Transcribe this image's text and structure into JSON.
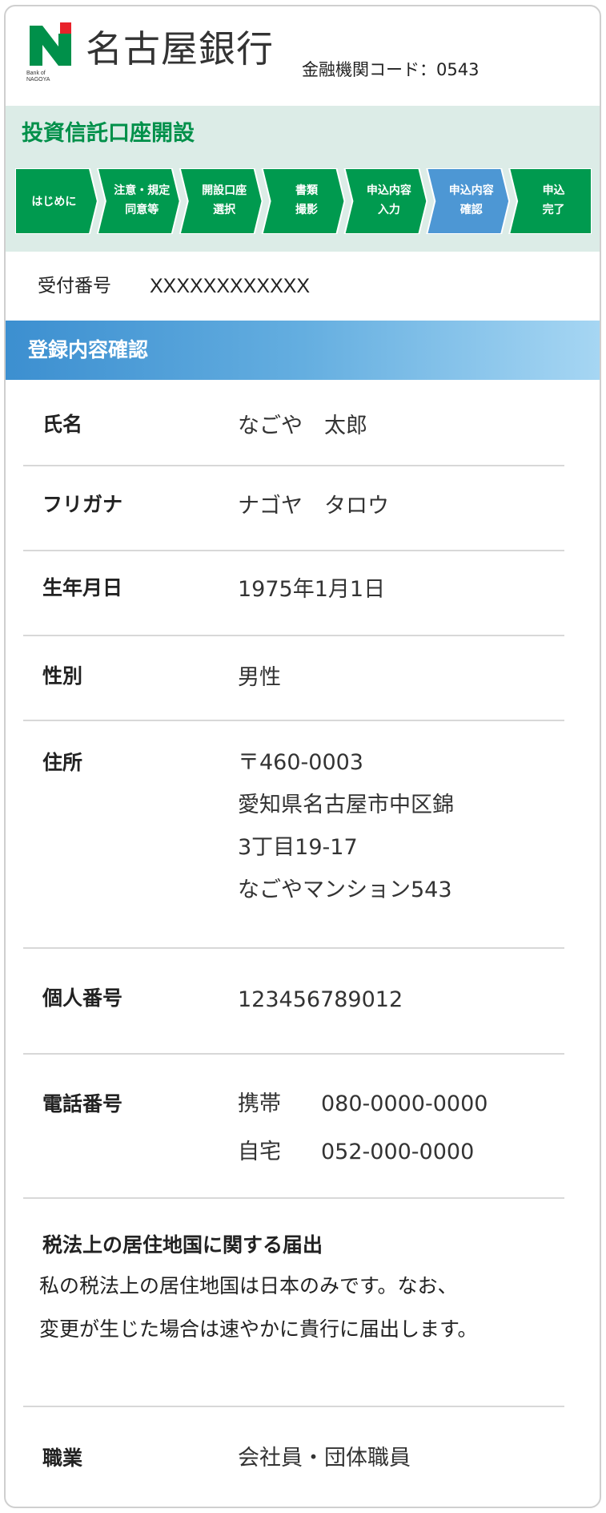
{
  "header": {
    "bank_name": "名古屋銀行",
    "logo_sub_line1": "Bank of",
    "logo_sub_line2": "NAGOYA",
    "institution_code": "金融機関コード：0543",
    "colors": {
      "logo_green": "#00904a",
      "logo_red": "#e8222a"
    }
  },
  "application": {
    "title": "投資信託口座開設",
    "steps": [
      {
        "line1": "はじめに",
        "line2": "",
        "state": "done"
      },
      {
        "line1": "注意・規定",
        "line2": "同意等",
        "state": "done"
      },
      {
        "line1": "開設口座",
        "line2": "選択",
        "state": "done"
      },
      {
        "line1": "書類",
        "line2": "撮影",
        "state": "done"
      },
      {
        "line1": "申込内容",
        "line2": "入力",
        "state": "done"
      },
      {
        "line1": "申込内容",
        "line2": "確認",
        "state": "current"
      },
      {
        "line1": "申込",
        "line2": "完了",
        "state": "todo"
      }
    ],
    "colors": {
      "step_green": "#009a4f",
      "step_current": "#4d97d4",
      "band_bg": "#dcece7"
    }
  },
  "receipt": {
    "label": "受付番号",
    "value": "XXXXXXXXXXXX"
  },
  "section": {
    "title": "登録内容確認"
  },
  "fields": {
    "name": {
      "label": "氏名",
      "value": "なごや　太郎"
    },
    "furigana": {
      "label": "フリガナ",
      "value": "ナゴヤ　タロウ"
    },
    "birthdate": {
      "label": "生年月日",
      "value": "1975年1月1日"
    },
    "gender": {
      "label": "性別",
      "value": "男性"
    },
    "address": {
      "label": "住所",
      "lines": [
        "〒460-0003",
        "愛知県名古屋市中区錦",
        "3丁目19-17",
        "なごやマンション543"
      ]
    },
    "my_number": {
      "label": "個人番号",
      "value": "123456789012"
    },
    "phone": {
      "label": "電話番号",
      "mobile_label": "携帯",
      "mobile_value": "080-0000-0000",
      "home_label": "自宅",
      "home_value": "052-000-0000"
    },
    "tax_residence": {
      "title": "税法上の居住地国に関する届出",
      "body_line1": "私の税法上の居住地国は日本のみです。なお、",
      "body_line2": "変更が生じた場合は速やかに貴行に届出します。"
    },
    "occupation": {
      "label": "職業",
      "value": "会社員・団体職員"
    }
  }
}
